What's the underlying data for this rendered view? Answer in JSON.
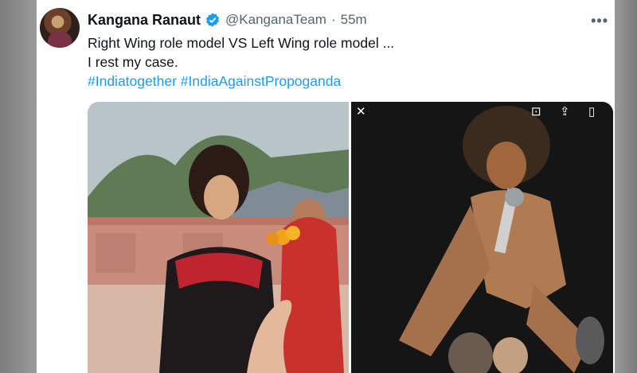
{
  "tweet": {
    "author_name": "Kangana Ranaut",
    "handle": "@KanganaTeam",
    "separator": "·",
    "time": "55m",
    "more_label": "•••",
    "lines": [
      "Right Wing role model VS Left Wing role model ...",
      "I rest my case."
    ],
    "hashtags": [
      "#Indiatogether",
      "#IndiaAgainstPropoganda"
    ]
  },
  "media": {
    "toolbar": {
      "close_glyph": "✕",
      "scan_glyph": "⊡",
      "share_glyph": "⇪",
      "bookmark_glyph": "▯"
    }
  },
  "colors": {
    "verified": "#1d9bf0",
    "link": "#1d9bf0",
    "text": "#0f1419",
    "muted": "#536471"
  },
  "icons": [
    "verified-badge-icon",
    "more-icon",
    "close-icon",
    "scan-icon",
    "share-icon",
    "bookmark-icon"
  ]
}
